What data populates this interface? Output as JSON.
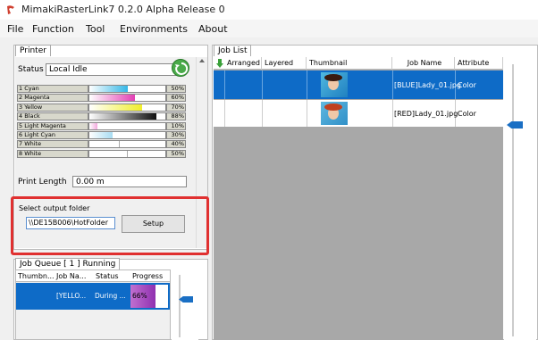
{
  "window": {
    "title": "MimakiRasterLink7 0.2.0 Alpha Release 0"
  },
  "menu": [
    "File",
    "Function",
    "Tool",
    "Environments",
    "About"
  ],
  "printer_panel": {
    "tab": "Printer",
    "status_label": "Status",
    "status_value": "Local Idle",
    "inks": [
      {
        "name": "1 Cyan",
        "pct": "50%",
        "level": 0.5,
        "color": "#35b7e6"
      },
      {
        "name": "2 Magenta",
        "pct": "60%",
        "level": 0.6,
        "color": "#e340b4"
      },
      {
        "name": "3 Yellow",
        "pct": "70%",
        "level": 0.7,
        "color": "#f0ee2a"
      },
      {
        "name": "4 Black",
        "pct": "88%",
        "level": 0.88,
        "color": "#111111"
      },
      {
        "name": "5 Light Magenta",
        "pct": "10%",
        "level": 0.1,
        "color": "#f2a8dc"
      },
      {
        "name": "6 Light Cyan",
        "pct": "30%",
        "level": 0.3,
        "color": "#a8dcf2"
      },
      {
        "name": "7 White",
        "pct": "40%",
        "level": 0.4,
        "color": "#ffffff"
      },
      {
        "name": "8 White",
        "pct": "50%",
        "level": 0.5,
        "color": "#ffffff"
      }
    ],
    "print_length_label": "Print Length",
    "print_length_value": "0.00 m",
    "output_folder_label": "Select output folder",
    "output_folder_value": "\\\\DE15B006\\HotFolder",
    "setup_button": "Setup"
  },
  "job_queue": {
    "tab": "Job Queue [ 1 ] Running",
    "columns": [
      "Thumbn...",
      "Job Na...",
      "Status",
      "Progress"
    ],
    "rows": [
      {
        "job_name": "[YELLO...",
        "status": "During ...",
        "progress": "66%",
        "progress_level": 0.66
      }
    ]
  },
  "job_list": {
    "tab": "Job List",
    "columns": [
      "Arranged",
      "Layered",
      "Thumbnail",
      "Job Name",
      "Attribute"
    ],
    "rows": [
      {
        "job_name": "[BLUE]Lady_01.jpg",
        "attribute": "Color",
        "selected": true
      },
      {
        "job_name": "[RED]Lady_01.jpg",
        "attribute": "Color",
        "selected": false
      }
    ]
  },
  "colors": {
    "selection": "#0e6bc7",
    "highlight_border": "#e03030",
    "progress_fill": "#a040c0"
  }
}
